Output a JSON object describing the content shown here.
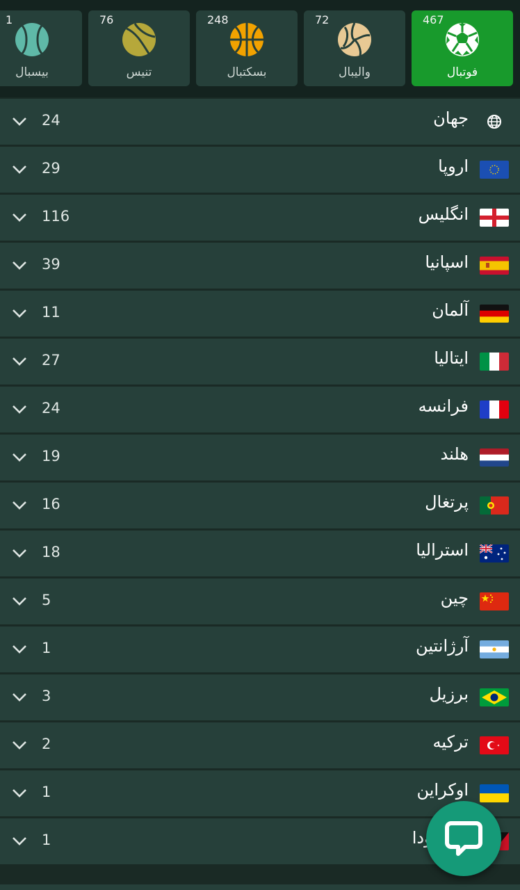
{
  "sports": [
    {
      "id": "football",
      "label": "فوتبال",
      "count": "467",
      "active": true,
      "icon": "soccer-ball-icon"
    },
    {
      "id": "volleyball",
      "label": "والیبال",
      "count": "72",
      "active": false,
      "icon": "volleyball-icon"
    },
    {
      "id": "basketball",
      "label": "بسکتبال",
      "count": "248",
      "active": false,
      "icon": "basketball-icon"
    },
    {
      "id": "tennis",
      "label": "تنیس",
      "count": "76",
      "active": false,
      "icon": "tennis-ball-icon"
    },
    {
      "id": "baseball",
      "label": "بیسبال",
      "count": "1",
      "active": false,
      "icon": "baseball-icon"
    }
  ],
  "countries": [
    {
      "name": "جهان",
      "count": "24",
      "flag": "world-globe-icon"
    },
    {
      "name": "اروپا",
      "count": "29",
      "flag": "eu-flag-icon"
    },
    {
      "name": "انگلیس",
      "count": "116",
      "flag": "england-flag-icon"
    },
    {
      "name": "اسپانیا",
      "count": "39",
      "flag": "spain-flag-icon"
    },
    {
      "name": "آلمان",
      "count": "11",
      "flag": "germany-flag-icon"
    },
    {
      "name": "ایتالیا",
      "count": "27",
      "flag": "italy-flag-icon"
    },
    {
      "name": "فرانسه",
      "count": "24",
      "flag": "france-flag-icon"
    },
    {
      "name": "هلند",
      "count": "19",
      "flag": "netherlands-flag-icon"
    },
    {
      "name": "پرتغال",
      "count": "16",
      "flag": "portugal-flag-icon"
    },
    {
      "name": "استرالیا",
      "count": "18",
      "flag": "australia-flag-icon"
    },
    {
      "name": "چین",
      "count": "5",
      "flag": "china-flag-icon"
    },
    {
      "name": "آرژانتین",
      "count": "1",
      "flag": "argentina-flag-icon"
    },
    {
      "name": "برزیل",
      "count": "3",
      "flag": "brazil-flag-icon"
    },
    {
      "name": "ترکیه",
      "count": "2",
      "flag": "turkey-flag-icon"
    },
    {
      "name": "اوکراین",
      "count": "1",
      "flag": "ukraine-flag-icon"
    },
    {
      "name": "و باربودا",
      "count": "1",
      "flag": "antigua-flag-icon"
    }
  ],
  "chat_button": {
    "icon": "chat-bubble-icon"
  },
  "colors": {
    "active_tile": "#189a2c",
    "tile": "#26403a",
    "background": "#14231f",
    "fab": "#159a78"
  }
}
